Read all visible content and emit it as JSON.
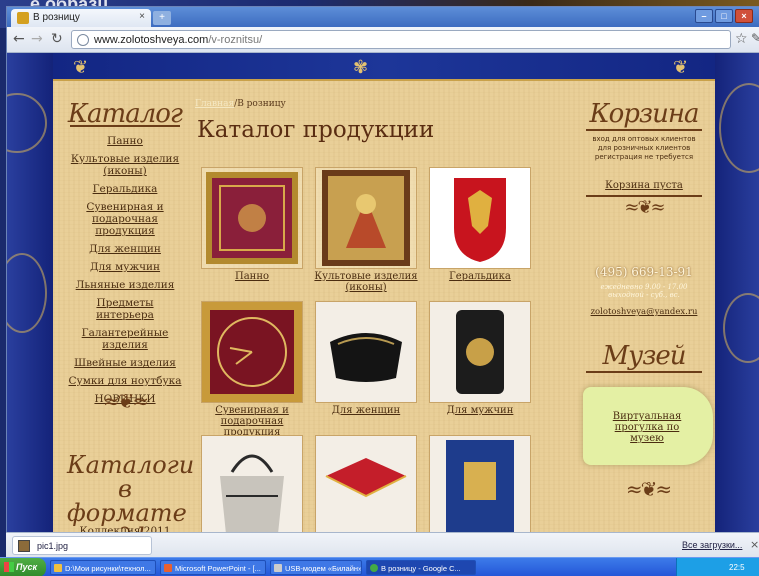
{
  "backdrop": {
    "text": "е образц"
  },
  "browser": {
    "tab_title": "В розницу",
    "url_host": "www.zolotoshveya.com",
    "url_path": "/v-roznitsu/"
  },
  "site": {
    "breadcrumb": {
      "home": "Главная",
      "current": "/В розницу"
    },
    "page_title": "Каталог продукции",
    "left": {
      "heading": "Каталог",
      "menu": [
        "Панно",
        "Культовые изделия (иконы)",
        "Геральдика",
        "Сувенирная и подарочная продукция",
        "Для женщин",
        "Для мужчин",
        "Льняные изделия",
        "Предметы интерьера",
        "Галантерейные изделия",
        "Швейные изделия",
        "Сумки для ноутбука",
        "НОВИНКИ"
      ],
      "catalog_pdf_heading": "Каталоги в формате пдф",
      "collection": "Коллекция 2011"
    },
    "products": [
      {
        "caption": "Панно",
        "colors": [
          "#b38a2e",
          "#8a1f3a",
          "#d8a94a"
        ]
      },
      {
        "caption": "Культовые изделия (иконы)",
        "colors": [
          "#6a3b1a",
          "#c8a050",
          "#b84a2a"
        ]
      },
      {
        "caption": "Геральдика",
        "colors": [
          "#ffffff",
          "#c8141e",
          "#e0b040"
        ]
      },
      {
        "caption": "Сувенирная и подарочная продукция",
        "colors": [
          "#c89a3a",
          "#7a1422",
          "#e0b860"
        ]
      },
      {
        "caption": "Для женщин",
        "colors": [
          "#f3eee6",
          "#141414",
          "#b89a52"
        ]
      },
      {
        "caption": "Для мужчин",
        "colors": [
          "#f3eee6",
          "#1c1c1c",
          "#c8a048"
        ]
      },
      {
        "caption": "",
        "colors": [
          "#f3eee6",
          "#c8c4bc",
          "#2a2a2a"
        ]
      },
      {
        "caption": "",
        "colors": [
          "#f3eee6",
          "#c41e2a",
          "#e0b040"
        ]
      },
      {
        "caption": "",
        "colors": [
          "#f3eee6",
          "#1e3c8c",
          "#d8b050"
        ]
      }
    ],
    "right": {
      "cart_heading": "Корзина",
      "cart_notes": [
        "вход для оптовых клиентов",
        "для розничных клиентов",
        "регистрация не требуется"
      ],
      "cart_empty": "Корзина пуста",
      "phone": "(495) 669-13-91",
      "hours": [
        "ежедневно 9.00 - 17.00",
        "выходной - суб., вс."
      ],
      "email": "zolotoshveya@yandex.ru",
      "museum_heading": "Музей",
      "museum_link": "Виртуальная прогулка по музею"
    }
  },
  "downloads": {
    "file": "pic1.jpg",
    "all": "Все загрузки..."
  },
  "taskbar": {
    "start": "Пуск",
    "items": [
      "D:\\Мои рисунки\\технол...",
      "Microsoft PowerPoint - [...",
      "USB-модем «Билайн»",
      "В розницу - Google C..."
    ],
    "clock": "22:5"
  }
}
